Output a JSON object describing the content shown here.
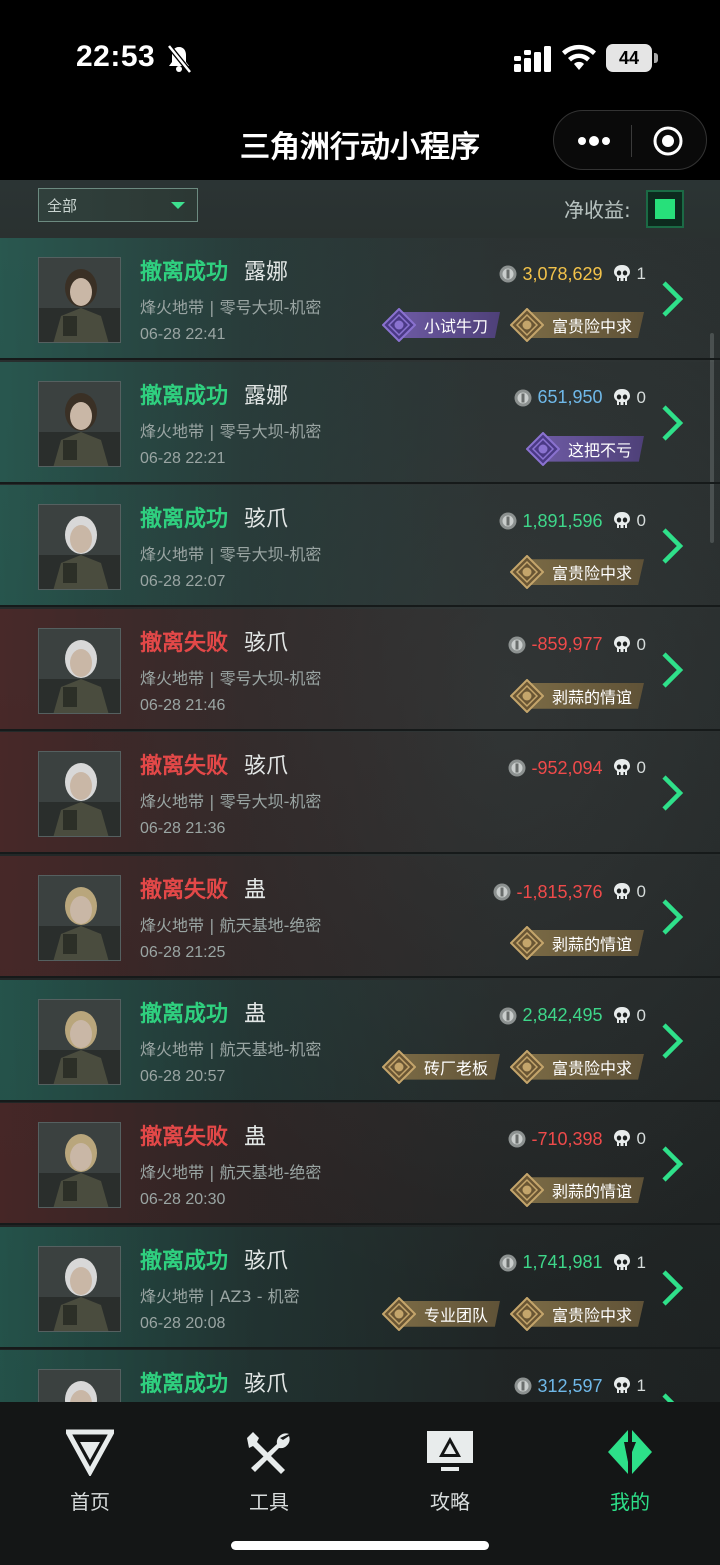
{
  "status_bar": {
    "time": "22:53",
    "battery": "44"
  },
  "nav": {
    "title": "三角洲行动小程序"
  },
  "filter": {
    "selected": "全部",
    "net_label": "净收益:"
  },
  "records": [
    {
      "outcome": "撤离成功",
      "result": "success",
      "operator": "露娜",
      "map": "烽火地带 | 零号大坝-机密",
      "time": "06-28 22:41",
      "value": "3,078,629",
      "value_color": "gold",
      "kills": "1",
      "badges": [
        {
          "label": "小试牛刀",
          "style": "purple"
        },
        {
          "label": "富贵险中求",
          "style": "gold"
        }
      ]
    },
    {
      "outcome": "撤离成功",
      "result": "success",
      "operator": "露娜",
      "map": "烽火地带 | 零号大坝-机密",
      "time": "06-28 22:21",
      "value": "651,950",
      "value_color": "blue",
      "kills": "0",
      "badges": [
        {
          "label": "这把不亏",
          "style": "purple"
        }
      ]
    },
    {
      "outcome": "撤离成功",
      "result": "success",
      "operator": "骇爪",
      "map": "烽火地带 | 零号大坝-机密",
      "time": "06-28 22:07",
      "value": "1,891,596",
      "value_color": "green",
      "kills": "0",
      "badges": [
        {
          "label": "富贵险中求",
          "style": "gold"
        }
      ]
    },
    {
      "outcome": "撤离失败",
      "result": "fail",
      "operator": "骇爪",
      "map": "烽火地带 | 零号大坝-机密",
      "time": "06-28 21:46",
      "value": "-859,977",
      "value_color": "red",
      "kills": "0",
      "badges": [
        {
          "label": "剥蒜的情谊",
          "style": "gold"
        }
      ]
    },
    {
      "outcome": "撤离失败",
      "result": "fail",
      "operator": "骇爪",
      "map": "烽火地带 | 零号大坝-机密",
      "time": "06-28 21:36",
      "value": "-952,094",
      "value_color": "red",
      "kills": "0",
      "badges": []
    },
    {
      "outcome": "撤离失败",
      "result": "fail",
      "operator": "蛊",
      "map": "烽火地带 | 航天基地-绝密",
      "time": "06-28 21:25",
      "value": "-1,815,376",
      "value_color": "red",
      "kills": "0",
      "badges": [
        {
          "label": "剥蒜的情谊",
          "style": "gold"
        }
      ]
    },
    {
      "outcome": "撤离成功",
      "result": "success",
      "operator": "蛊",
      "map": "烽火地带 | 航天基地-机密",
      "time": "06-28 20:57",
      "value": "2,842,495",
      "value_color": "green",
      "kills": "0",
      "badges": [
        {
          "label": "砖厂老板",
          "style": "gold"
        },
        {
          "label": "富贵险中求",
          "style": "gold"
        }
      ]
    },
    {
      "outcome": "撤离失败",
      "result": "fail",
      "operator": "蛊",
      "map": "烽火地带 | 航天基地-绝密",
      "time": "06-28 20:30",
      "value": "-710,398",
      "value_color": "red",
      "kills": "0",
      "badges": [
        {
          "label": "剥蒜的情谊",
          "style": "gold"
        }
      ]
    },
    {
      "outcome": "撤离成功",
      "result": "success",
      "operator": "骇爪",
      "map": "烽火地带 | AZ3 - 机密",
      "time": "06-28 20:08",
      "value": "1,741,981",
      "value_color": "green",
      "kills": "1",
      "badges": [
        {
          "label": "专业团队",
          "style": "gold"
        },
        {
          "label": "富贵险中求",
          "style": "gold"
        }
      ]
    },
    {
      "outcome": "撤离成功",
      "result": "success",
      "operator": "骇爪",
      "map": "",
      "time": "",
      "value": "312,597",
      "value_color": "blue",
      "kills": "1",
      "badges": []
    }
  ],
  "tabs": [
    {
      "label": "首页",
      "icon": "delta-logo-icon"
    },
    {
      "label": "工具",
      "icon": "tools-icon"
    },
    {
      "label": "攻略",
      "icon": "monitor-guide-icon"
    },
    {
      "label": "我的",
      "icon": "profile-logo-icon",
      "active": true
    }
  ],
  "colors": {
    "accent": "#2de089",
    "success": "#2fd07f",
    "fail": "#e34848",
    "gold_value": "#f2c24a",
    "blue_value": "#6fb8e8"
  }
}
